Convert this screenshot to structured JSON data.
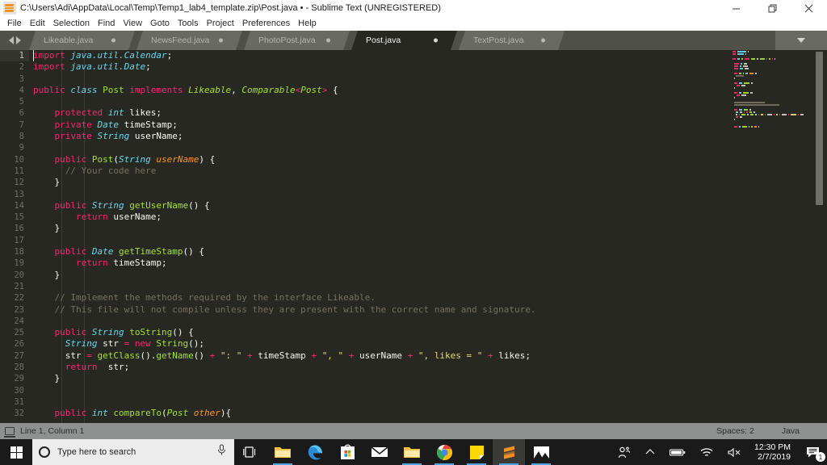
{
  "window": {
    "title": "C:\\Users\\Adi\\AppData\\Local\\Temp\\Temp1_lab4_template.zip\\Post.java • - Sublime Text (UNREGISTERED)",
    "app_icon": "sublime-text-icon",
    "controls": {
      "minimize": "minimize-icon",
      "maximize": "restore-icon",
      "close": "close-icon"
    }
  },
  "menubar": {
    "items": [
      {
        "label": "File"
      },
      {
        "label": "Edit"
      },
      {
        "label": "Selection"
      },
      {
        "label": "Find"
      },
      {
        "label": "View"
      },
      {
        "label": "Goto"
      },
      {
        "label": "Tools"
      },
      {
        "label": "Project"
      },
      {
        "label": "Preferences"
      },
      {
        "label": "Help"
      }
    ]
  },
  "tabbar": {
    "scroll_left_icon": "chevron-left-icon",
    "scroll_right_icon": "chevron-right-icon",
    "overflow_icon": "chevron-down-icon",
    "tabs": [
      {
        "label": "Likeable.java",
        "active": false,
        "dirty": true
      },
      {
        "label": "NewsFeed.java",
        "active": false,
        "dirty": true
      },
      {
        "label": "PhotoPost.java",
        "active": false,
        "dirty": true
      },
      {
        "label": "Post.java",
        "active": true,
        "dirty": true
      },
      {
        "label": "TextPost.java",
        "active": false,
        "dirty": true
      }
    ]
  },
  "editor": {
    "language": "Java",
    "theme": "Monokai",
    "background": "#272822",
    "cursor_line": 1,
    "lines": [
      {
        "n": 1,
        "tokens": [
          {
            "c": "k",
            "t": "import"
          },
          {
            "c": "pl",
            "t": " "
          },
          {
            "c": "t",
            "t": "java.util.Calendar"
          },
          {
            "c": "pl",
            "t": ";"
          }
        ]
      },
      {
        "n": 2,
        "tokens": [
          {
            "c": "k",
            "t": "import"
          },
          {
            "c": "pl",
            "t": " "
          },
          {
            "c": "t",
            "t": "java.util.Date"
          },
          {
            "c": "pl",
            "t": ";"
          }
        ]
      },
      {
        "n": 3,
        "tokens": []
      },
      {
        "n": 4,
        "tokens": [
          {
            "c": "k",
            "t": "public"
          },
          {
            "c": "pl",
            "t": " "
          },
          {
            "c": "t",
            "t": "class"
          },
          {
            "c": "pl",
            "t": " "
          },
          {
            "c": "cls",
            "t": "Post"
          },
          {
            "c": "pl",
            "t": " "
          },
          {
            "c": "k",
            "t": "implements"
          },
          {
            "c": "pl",
            "t": " "
          },
          {
            "c": "cln",
            "t": "Likeable"
          },
          {
            "c": "pl",
            "t": ", "
          },
          {
            "c": "cln",
            "t": "Comparable"
          },
          {
            "c": "op",
            "t": "<"
          },
          {
            "c": "cln",
            "t": "Post"
          },
          {
            "c": "op",
            "t": ">"
          },
          {
            "c": "pl",
            "t": " {"
          }
        ]
      },
      {
        "n": 5,
        "tokens": []
      },
      {
        "n": 6,
        "tokens": [
          {
            "c": "pl",
            "t": "    "
          },
          {
            "c": "k",
            "t": "protected"
          },
          {
            "c": "pl",
            "t": " "
          },
          {
            "c": "t",
            "t": "int"
          },
          {
            "c": "pl",
            "t": " likes;"
          }
        ]
      },
      {
        "n": 7,
        "tokens": [
          {
            "c": "pl",
            "t": "    "
          },
          {
            "c": "k",
            "t": "private"
          },
          {
            "c": "pl",
            "t": " "
          },
          {
            "c": "t",
            "t": "Date"
          },
          {
            "c": "pl",
            "t": " timeStamp;"
          }
        ]
      },
      {
        "n": 8,
        "tokens": [
          {
            "c": "pl",
            "t": "    "
          },
          {
            "c": "k",
            "t": "private"
          },
          {
            "c": "pl",
            "t": " "
          },
          {
            "c": "t",
            "t": "String"
          },
          {
            "c": "pl",
            "t": " userName;"
          }
        ]
      },
      {
        "n": 9,
        "tokens": []
      },
      {
        "n": 10,
        "tokens": [
          {
            "c": "pl",
            "t": "    "
          },
          {
            "c": "k",
            "t": "public"
          },
          {
            "c": "pl",
            "t": " "
          },
          {
            "c": "cls",
            "t": "Post"
          },
          {
            "c": "pl",
            "t": "("
          },
          {
            "c": "t",
            "t": "String"
          },
          {
            "c": "pl",
            "t": " "
          },
          {
            "c": "par",
            "t": "userName"
          },
          {
            "c": "pl",
            "t": ") {"
          }
        ]
      },
      {
        "n": 11,
        "tokens": [
          {
            "c": "cm",
            "t": "      // Your code here"
          }
        ]
      },
      {
        "n": 12,
        "tokens": [
          {
            "c": "pl",
            "t": "    }"
          }
        ]
      },
      {
        "n": 13,
        "tokens": []
      },
      {
        "n": 14,
        "tokens": [
          {
            "c": "pl",
            "t": "    "
          },
          {
            "c": "k",
            "t": "public"
          },
          {
            "c": "pl",
            "t": " "
          },
          {
            "c": "t",
            "t": "String"
          },
          {
            "c": "pl",
            "t": " "
          },
          {
            "c": "cls",
            "t": "getUserName"
          },
          {
            "c": "pl",
            "t": "() {"
          }
        ]
      },
      {
        "n": 15,
        "tokens": [
          {
            "c": "pl",
            "t": "        "
          },
          {
            "c": "k",
            "t": "return"
          },
          {
            "c": "pl",
            "t": " userName;"
          }
        ]
      },
      {
        "n": 16,
        "tokens": [
          {
            "c": "pl",
            "t": "    }"
          }
        ]
      },
      {
        "n": 17,
        "tokens": []
      },
      {
        "n": 18,
        "tokens": [
          {
            "c": "pl",
            "t": "    "
          },
          {
            "c": "k",
            "t": "public"
          },
          {
            "c": "pl",
            "t": " "
          },
          {
            "c": "t",
            "t": "Date"
          },
          {
            "c": "pl",
            "t": " "
          },
          {
            "c": "cls",
            "t": "getTimeStamp"
          },
          {
            "c": "pl",
            "t": "() {"
          }
        ]
      },
      {
        "n": 19,
        "tokens": [
          {
            "c": "pl",
            "t": "        "
          },
          {
            "c": "k",
            "t": "return"
          },
          {
            "c": "pl",
            "t": " timeStamp;"
          }
        ]
      },
      {
        "n": 20,
        "tokens": [
          {
            "c": "pl",
            "t": "    }"
          }
        ]
      },
      {
        "n": 21,
        "tokens": []
      },
      {
        "n": 22,
        "tokens": [
          {
            "c": "cm",
            "t": "    // Implement the methods required by the interface Likeable."
          }
        ]
      },
      {
        "n": 23,
        "tokens": [
          {
            "c": "cm",
            "t": "    // This file will not compile unless they are present with the correct name and signature."
          }
        ]
      },
      {
        "n": 24,
        "tokens": []
      },
      {
        "n": 25,
        "tokens": [
          {
            "c": "pl",
            "t": "    "
          },
          {
            "c": "k",
            "t": "public"
          },
          {
            "c": "pl",
            "t": " "
          },
          {
            "c": "t",
            "t": "String"
          },
          {
            "c": "pl",
            "t": " "
          },
          {
            "c": "cls",
            "t": "toString"
          },
          {
            "c": "pl",
            "t": "() {"
          }
        ]
      },
      {
        "n": 26,
        "tokens": [
          {
            "c": "pl",
            "t": "      "
          },
          {
            "c": "t",
            "t": "String"
          },
          {
            "c": "pl",
            "t": " str "
          },
          {
            "c": "op",
            "t": "="
          },
          {
            "c": "pl",
            "t": " "
          },
          {
            "c": "k",
            "t": "new"
          },
          {
            "c": "pl",
            "t": " "
          },
          {
            "c": "cls",
            "t": "String"
          },
          {
            "c": "pl",
            "t": "();"
          }
        ]
      },
      {
        "n": 27,
        "tokens": [
          {
            "c": "pl",
            "t": "      str "
          },
          {
            "c": "op",
            "t": "="
          },
          {
            "c": "pl",
            "t": " "
          },
          {
            "c": "cls",
            "t": "getClass"
          },
          {
            "c": "pl",
            "t": "()."
          },
          {
            "c": "cls",
            "t": "getName"
          },
          {
            "c": "pl",
            "t": "() "
          },
          {
            "c": "op",
            "t": "+"
          },
          {
            "c": "pl",
            "t": " "
          },
          {
            "c": "str",
            "t": "\": \""
          },
          {
            "c": "pl",
            "t": " "
          },
          {
            "c": "op",
            "t": "+"
          },
          {
            "c": "pl",
            "t": " timeStamp "
          },
          {
            "c": "op",
            "t": "+"
          },
          {
            "c": "pl",
            "t": " "
          },
          {
            "c": "str",
            "t": "\", \""
          },
          {
            "c": "pl",
            "t": " "
          },
          {
            "c": "op",
            "t": "+"
          },
          {
            "c": "pl",
            "t": " userName "
          },
          {
            "c": "op",
            "t": "+"
          },
          {
            "c": "pl",
            "t": " "
          },
          {
            "c": "str",
            "t": "\", likes = \""
          },
          {
            "c": "pl",
            "t": " "
          },
          {
            "c": "op",
            "t": "+"
          },
          {
            "c": "pl",
            "t": " likes;"
          }
        ]
      },
      {
        "n": 28,
        "tokens": [
          {
            "c": "pl",
            "t": "      "
          },
          {
            "c": "k",
            "t": "return"
          },
          {
            "c": "pl",
            "t": "  str;"
          }
        ]
      },
      {
        "n": 29,
        "tokens": [
          {
            "c": "pl",
            "t": "    }"
          }
        ]
      },
      {
        "n": 30,
        "tokens": []
      },
      {
        "n": 31,
        "tokens": []
      },
      {
        "n": 32,
        "tokens": [
          {
            "c": "pl",
            "t": "    "
          },
          {
            "c": "k",
            "t": "public"
          },
          {
            "c": "pl",
            "t": " "
          },
          {
            "c": "t",
            "t": "int"
          },
          {
            "c": "pl",
            "t": " "
          },
          {
            "c": "cls",
            "t": "compareTo"
          },
          {
            "c": "pl",
            "t": "("
          },
          {
            "c": "cln",
            "t": "Post"
          },
          {
            "c": "pl",
            "t": " "
          },
          {
            "c": "par",
            "t": "other"
          },
          {
            "c": "pl",
            "t": "){"
          }
        ]
      }
    ]
  },
  "statusbar": {
    "encoding_icon": "save-indicator-icon",
    "position": "Line 1, Column 1",
    "indentation": "Spaces: 2",
    "syntax": "Java"
  },
  "taskbar": {
    "start_icon": "windows-start-icon",
    "search_placeholder": "Type here to search",
    "mic_icon": "microphone-icon",
    "taskview_icon": "task-view-icon",
    "apps": [
      {
        "name": "file-explorer-icon",
        "label": "File Explorer",
        "running": true,
        "active": false
      },
      {
        "name": "edge-icon",
        "label": "Microsoft Edge",
        "running": false,
        "active": false
      },
      {
        "name": "microsoft-store-icon",
        "label": "Microsoft Store",
        "running": false,
        "active": false
      },
      {
        "name": "mail-icon",
        "label": "Mail",
        "running": false,
        "active": false
      },
      {
        "name": "file-explorer-2-icon",
        "label": "File Explorer",
        "running": true,
        "active": false
      },
      {
        "name": "chrome-icon",
        "label": "Google Chrome",
        "running": true,
        "active": false
      },
      {
        "name": "sticky-notes-icon",
        "label": "Sticky Notes",
        "running": true,
        "active": false
      },
      {
        "name": "sublime-text-icon",
        "label": "Sublime Text",
        "running": true,
        "active": true
      },
      {
        "name": "photos-icon",
        "label": "Photos",
        "running": true,
        "active": false
      }
    ],
    "tray": {
      "people_icon": "people-icon",
      "show_hidden_icon": "show-hidden-icons-chevron",
      "battery_icon": "battery-icon",
      "network_icon": "wifi-icon",
      "volume_icon": "volume-muted-icon",
      "time": "12:30 PM",
      "date": "2/7/2019",
      "notifications_icon": "action-center-icon",
      "notifications_count": "1"
    }
  }
}
